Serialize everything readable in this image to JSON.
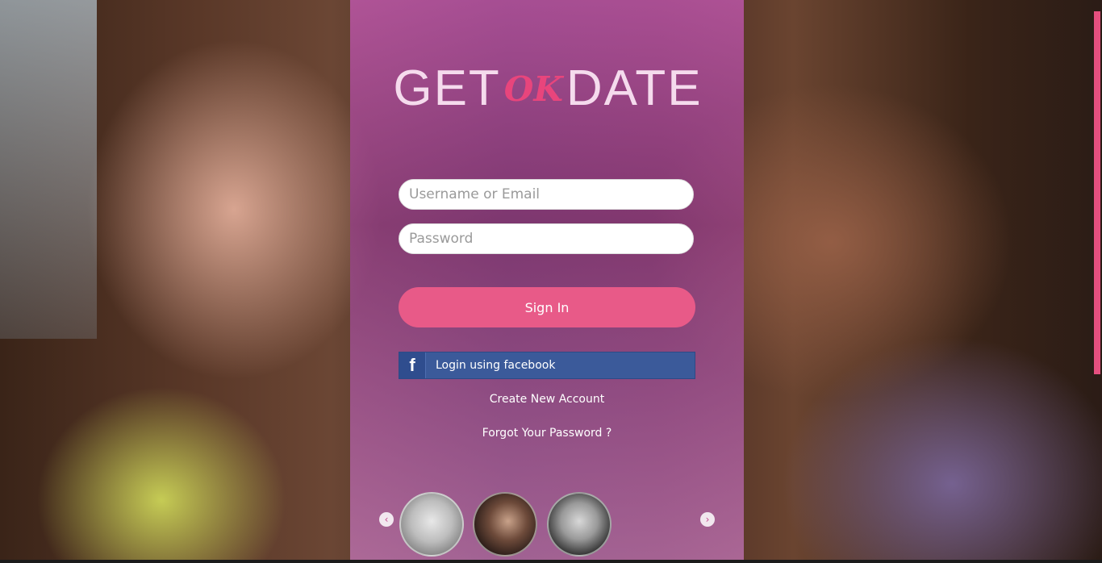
{
  "logo": {
    "part1": "GET",
    "part2": "OK",
    "part3": "DATE"
  },
  "login": {
    "username_placeholder": "Username or Email",
    "password_placeholder": "Password",
    "signin_label": "Sign In",
    "facebook_icon": "f",
    "facebook_label": "Login using facebook",
    "create_account": "Create New Account",
    "forgot_password": "Forgot Your Password ?"
  },
  "carousel": {
    "prev_icon": "‹",
    "next_icon": "›"
  },
  "colors": {
    "accent": "#e85a88",
    "facebook": "#3b5a9a",
    "panel": "#c458b2"
  }
}
